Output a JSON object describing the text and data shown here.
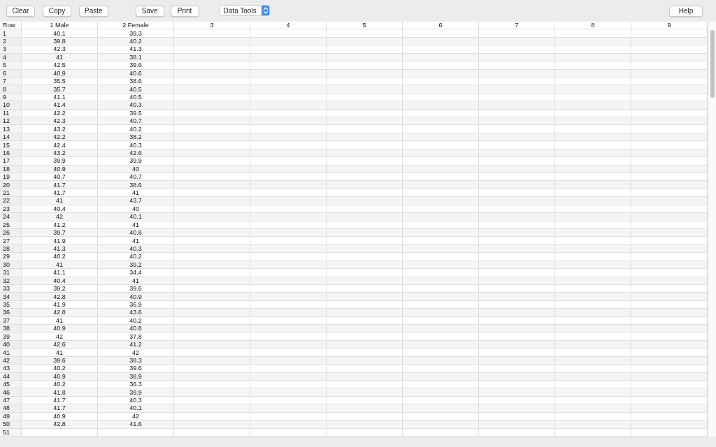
{
  "toolbar": {
    "edit_buttons": [
      "Clear",
      "Copy",
      "Paste"
    ],
    "file_buttons": [
      "Save",
      "Print"
    ],
    "dropdown": {
      "value": "Data Tools"
    },
    "help_button": "Help"
  },
  "table": {
    "row_header": "Row",
    "columns": [
      "1 Male",
      "2 Female",
      "3",
      "4",
      "5",
      "6",
      "7",
      "8",
      "9"
    ],
    "rows": [
      {
        "number": "1",
        "values": [
          "40.1",
          "39.3"
        ]
      },
      {
        "number": "2",
        "values": [
          "39.8",
          "40.2"
        ]
      },
      {
        "number": "3",
        "values": [
          "42.3",
          "41.3"
        ]
      },
      {
        "number": "4",
        "values": [
          "41",
          "38.1"
        ]
      },
      {
        "number": "5",
        "values": [
          "42.5",
          "39.6"
        ]
      },
      {
        "number": "6",
        "values": [
          "40.9",
          "40.6"
        ]
      },
      {
        "number": "7",
        "values": [
          "35.5",
          "38.6"
        ]
      },
      {
        "number": "8",
        "values": [
          "35.7",
          "40.5"
        ]
      },
      {
        "number": "9",
        "values": [
          "41.1",
          "40.5"
        ]
      },
      {
        "number": "10",
        "values": [
          "41.4",
          "40.3"
        ]
      },
      {
        "number": "11",
        "values": [
          "42.2",
          "39.5"
        ]
      },
      {
        "number": "12",
        "values": [
          "42.3",
          "40.7"
        ]
      },
      {
        "number": "13",
        "values": [
          "43.2",
          "40.2"
        ]
      },
      {
        "number": "14",
        "values": [
          "42.2",
          "38.2"
        ]
      },
      {
        "number": "15",
        "values": [
          "42.4",
          "40.3"
        ]
      },
      {
        "number": "16",
        "values": [
          "43.2",
          "42.6"
        ]
      },
      {
        "number": "17",
        "values": [
          "39.9",
          "39.9"
        ]
      },
      {
        "number": "18",
        "values": [
          "40.9",
          "40"
        ]
      },
      {
        "number": "19",
        "values": [
          "40.7",
          "40.7"
        ]
      },
      {
        "number": "20",
        "values": [
          "41.7",
          "38.6"
        ]
      },
      {
        "number": "21",
        "values": [
          "41.7",
          "41"
        ]
      },
      {
        "number": "22",
        "values": [
          "41",
          "43.7"
        ]
      },
      {
        "number": "23",
        "values": [
          "40.4",
          "40"
        ]
      },
      {
        "number": "24",
        "values": [
          "42",
          "40.1"
        ]
      },
      {
        "number": "25",
        "values": [
          "41.2",
          "41"
        ]
      },
      {
        "number": "26",
        "values": [
          "39.7",
          "40.8"
        ]
      },
      {
        "number": "27",
        "values": [
          "41.9",
          "41"
        ]
      },
      {
        "number": "28",
        "values": [
          "41.3",
          "40.3"
        ]
      },
      {
        "number": "29",
        "values": [
          "40.2",
          "40.2"
        ]
      },
      {
        "number": "30",
        "values": [
          "41",
          "39.2"
        ]
      },
      {
        "number": "31",
        "values": [
          "41.1",
          "34.4"
        ]
      },
      {
        "number": "32",
        "values": [
          "40.4",
          "41"
        ]
      },
      {
        "number": "33",
        "values": [
          "39.2",
          "39.6"
        ]
      },
      {
        "number": "34",
        "values": [
          "42.8",
          "40.9"
        ]
      },
      {
        "number": "35",
        "values": [
          "41.9",
          "36.9"
        ]
      },
      {
        "number": "36",
        "values": [
          "42.8",
          "43.6"
        ]
      },
      {
        "number": "37",
        "values": [
          "41",
          "40.2"
        ]
      },
      {
        "number": "38",
        "values": [
          "40.9",
          "40.8"
        ]
      },
      {
        "number": "39",
        "values": [
          "42",
          "37.8"
        ]
      },
      {
        "number": "40",
        "values": [
          "42.6",
          "41.2"
        ]
      },
      {
        "number": "41",
        "values": [
          "41",
          "42"
        ]
      },
      {
        "number": "42",
        "values": [
          "39.6",
          "38.3"
        ]
      },
      {
        "number": "43",
        "values": [
          "40.2",
          "39.6"
        ]
      },
      {
        "number": "44",
        "values": [
          "40.9",
          "38.9"
        ]
      },
      {
        "number": "45",
        "values": [
          "40.2",
          "36.3"
        ]
      },
      {
        "number": "46",
        "values": [
          "41.8",
          "39.9"
        ]
      },
      {
        "number": "47",
        "values": [
          "41.7",
          "40.3"
        ]
      },
      {
        "number": "48",
        "values": [
          "41.7",
          "40.1"
        ]
      },
      {
        "number": "49",
        "values": [
          "40.9",
          "42"
        ]
      },
      {
        "number": "50",
        "values": [
          "42.8",
          "41.6"
        ]
      },
      {
        "number": "51",
        "values": []
      }
    ]
  }
}
